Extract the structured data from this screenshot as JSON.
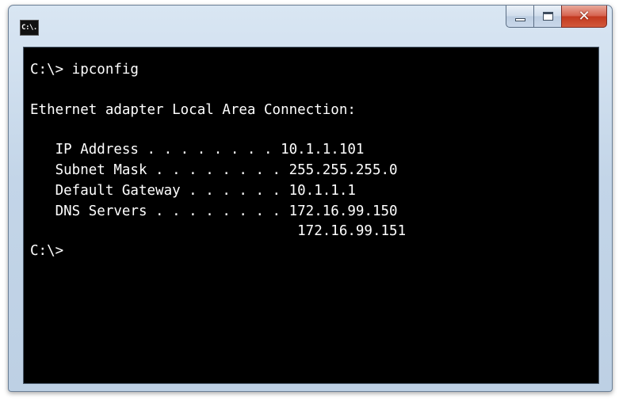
{
  "window": {
    "icon_text": "C:\\.",
    "controls": {
      "minimize": "minimize",
      "maximize": "maximize",
      "close": "close"
    }
  },
  "console": {
    "lines": [
      "C:\\> ipconfig",
      "Ethernet adapter Local Area Connection:",
      "   IP Address . . . . . . . . 10.1.1.101",
      "   Subnet Mask . . . . . . . . 255.255.255.0",
      "   Default Gateway . . . . . . 10.1.1.1",
      "   DNS Servers . . . . . . . . 172.16.99.150",
      "                                172.16.99.151",
      "C:\\>"
    ]
  },
  "colors": {
    "console_background": "#000000",
    "console_text": "#ffffff",
    "title_bar": "#c3d5e8",
    "close_button": "#c2391f"
  }
}
